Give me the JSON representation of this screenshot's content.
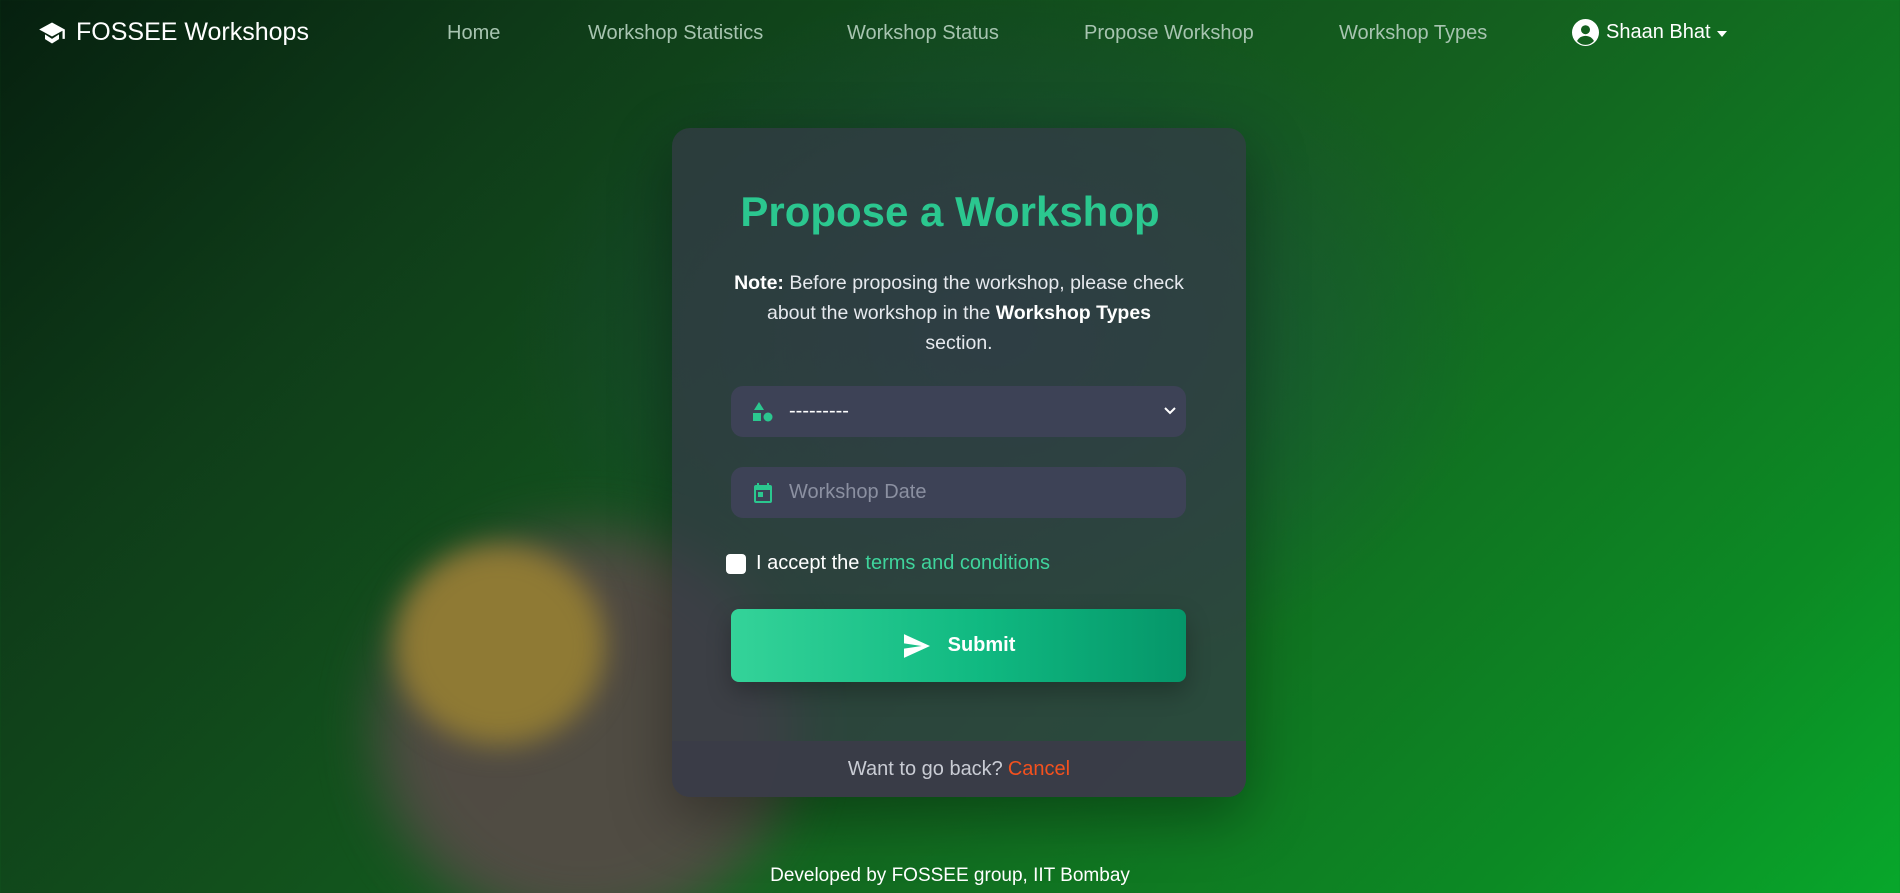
{
  "navbar": {
    "brand": "FOSSEE Workshops",
    "brand_icon": "graduation-cap-icon",
    "links": [
      {
        "label": "Home"
      },
      {
        "label": "Workshop Statistics"
      },
      {
        "label": "Workshop Status"
      },
      {
        "label": "Propose Workshop"
      },
      {
        "label": "Workshop Types"
      }
    ],
    "user": {
      "name": "Shaan Bhat",
      "icon": "user-circle-icon"
    }
  },
  "form": {
    "title": "Propose a Workshop",
    "note_label": "Note:",
    "note_text_1": "Before proposing the workshop, please check about the workshop in the",
    "note_emphasis": "Workshop Types",
    "note_text_2": "section.",
    "workshop_type": {
      "selected": "---------",
      "icon": "shapes-icon"
    },
    "workshop_date": {
      "placeholder": "Workshop Date",
      "value": "",
      "icon": "calendar-icon"
    },
    "terms": {
      "prefix": "I accept the",
      "link": "terms and conditions",
      "checked": false
    },
    "submit_label": "Submit",
    "submit_icon": "send-icon",
    "footer_text": "Want to go back?",
    "cancel_label": "Cancel"
  },
  "footer": {
    "text": "Developed by FOSSEE group, IIT Bombay"
  },
  "colors": {
    "accent": "#2bc78f",
    "link": "#3fd49c",
    "cancel": "#f4511e",
    "nav_link": "#a7c4b0"
  }
}
